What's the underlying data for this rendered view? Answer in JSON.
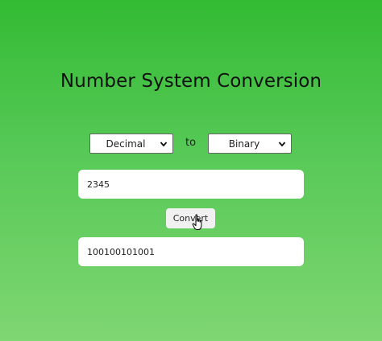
{
  "page": {
    "title": "Number System Conversion"
  },
  "converter": {
    "from_select": {
      "selected": "Decimal"
    },
    "to_label": "to",
    "to_select": {
      "selected": "Binary"
    },
    "input_value": "2345",
    "convert_label": "Convert",
    "output_value": "100100101001"
  },
  "icons": {
    "select_chevron": "chevron-down-icon",
    "cursor": "hand-pointer-icon"
  },
  "colors": {
    "background_top": "#33bb33",
    "background_bottom": "#7fd672",
    "field_bg": "#ffffff",
    "button_bg": "#f1f1f1",
    "text": "#111111"
  }
}
